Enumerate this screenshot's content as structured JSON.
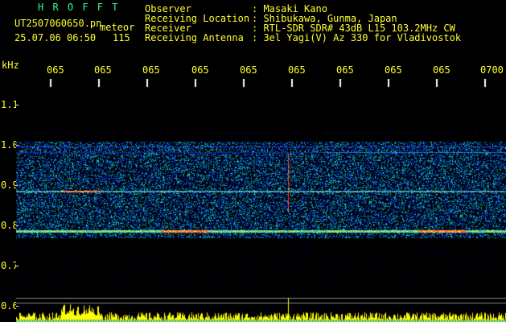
{
  "header": {
    "logo": "H R O F F T",
    "filename": "UT2507060650.pn",
    "mode": "meteor",
    "datetime": "25.07.06 06:50",
    "count": "115",
    "fields": [
      {
        "label": "Observer",
        "value": ": Masaki Kano"
      },
      {
        "label": "Receiving Location",
        "value": ": Shibukawa, Gunma, Japan"
      },
      {
        "label": "Receiver",
        "value": ": RTL-SDR SDR# 43dB L15 103.2MHz CW"
      },
      {
        "label": "Receiving Antenna",
        "value": ": 3el Yagi(V) Az 330 for Vladivostok"
      }
    ]
  },
  "axes": {
    "y_unit": "kHz",
    "y_ticks": [
      "1.1",
      "1.0",
      "0.9",
      "0.8",
      "0.7",
      "0.6"
    ],
    "x_ticks": [
      "065",
      "065",
      "065",
      "065",
      "065",
      "065",
      "065",
      "065",
      "065",
      "0700"
    ]
  },
  "colors": {
    "header_text": "#ffff30",
    "logo": "#30ff90",
    "axis_text": "#ffff30",
    "background": "#000000",
    "signal_hot": "#ff3030",
    "amplitude_bars": "#ffff00"
  }
}
